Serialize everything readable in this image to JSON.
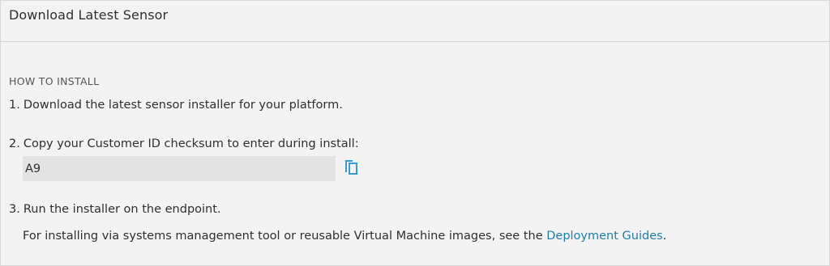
{
  "panel": {
    "title": "Download Latest Sensor"
  },
  "install": {
    "heading": "HOW TO INSTALL",
    "steps": [
      {
        "num": "1.",
        "text": "Download the latest sensor installer for your platform."
      },
      {
        "num": "2.",
        "text": "Copy your Customer ID checksum to enter during install:"
      },
      {
        "num": "3.",
        "text": "Run the installer on the endpoint."
      }
    ],
    "customer_id": {
      "value": "A9",
      "copy_icon": "copy-icon"
    },
    "note": {
      "text": "For installing via systems management tool or reusable Virtual Machine images, see the ",
      "link_label": "Deployment Guides",
      "suffix": "."
    }
  },
  "colors": {
    "link": "#1f7ea8",
    "copy_icon": "#3a9bd1",
    "field_bg": "#e3e3e3",
    "page_bg": "#f3f3f3"
  }
}
